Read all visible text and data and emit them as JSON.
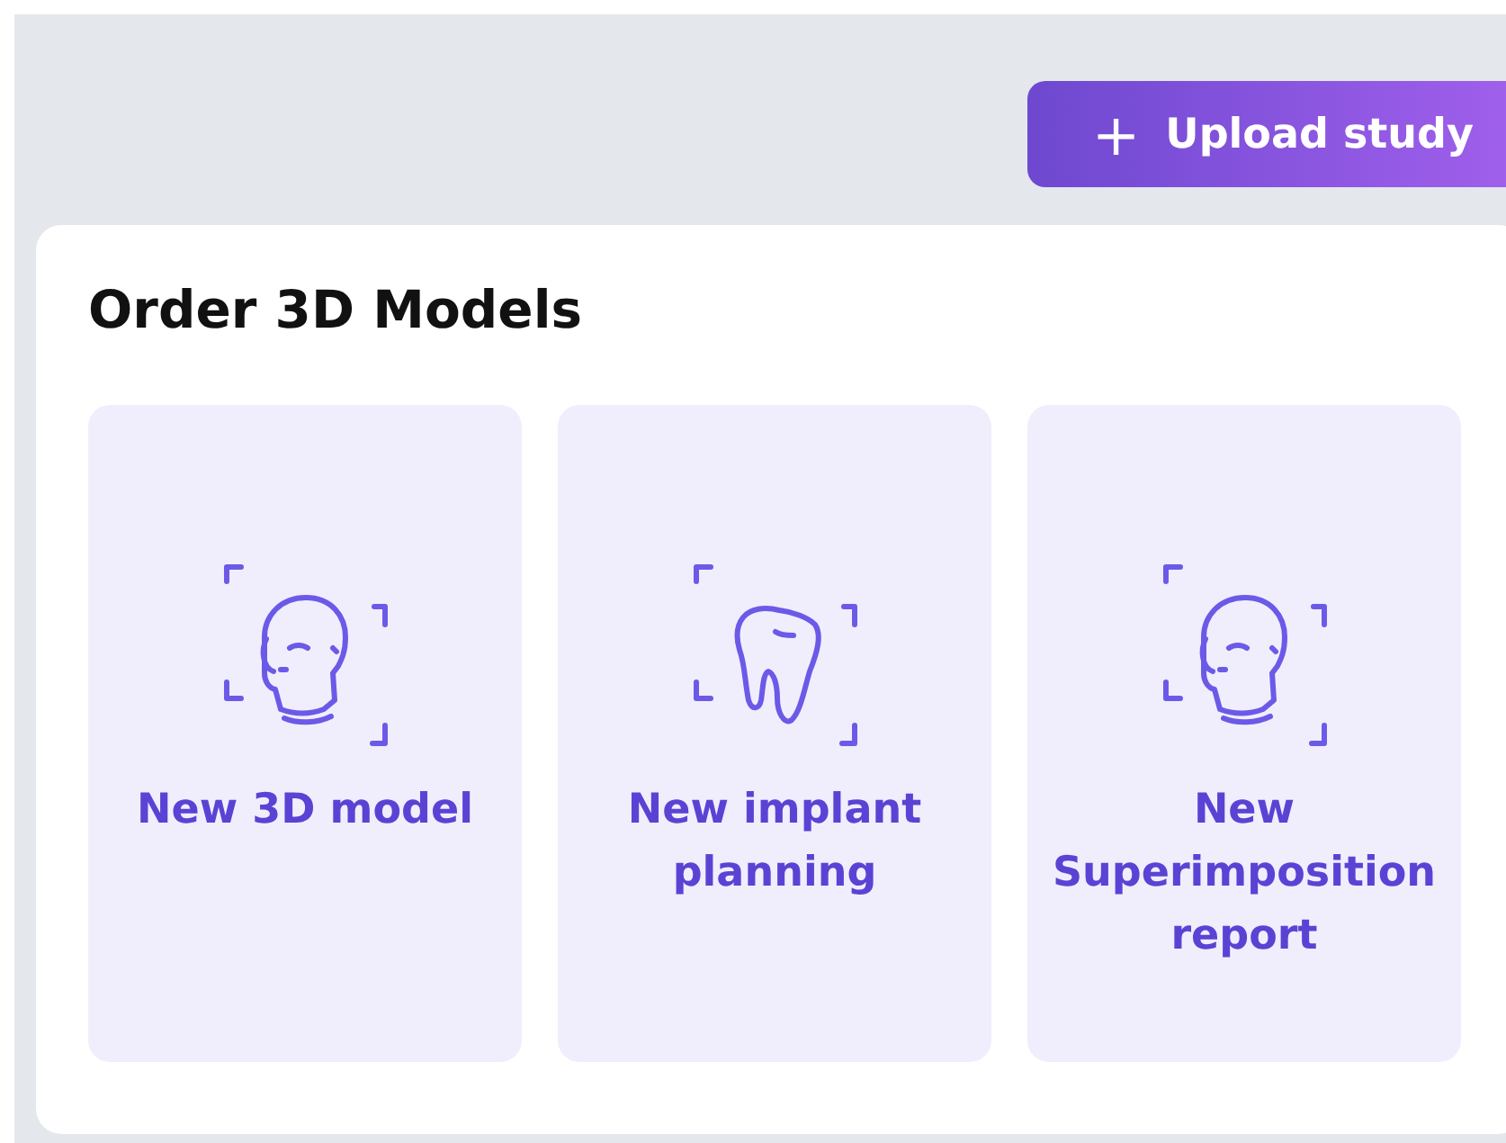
{
  "header": {
    "upload_button": {
      "icon": "+",
      "label": "Upload study"
    }
  },
  "card": {
    "title": "Order 3D Models",
    "tiles": [
      {
        "kind": "head",
        "label": "New 3D model"
      },
      {
        "kind": "tooth",
        "label": "New implant planning"
      },
      {
        "kind": "head",
        "label": "New Superimposition report"
      }
    ]
  }
}
